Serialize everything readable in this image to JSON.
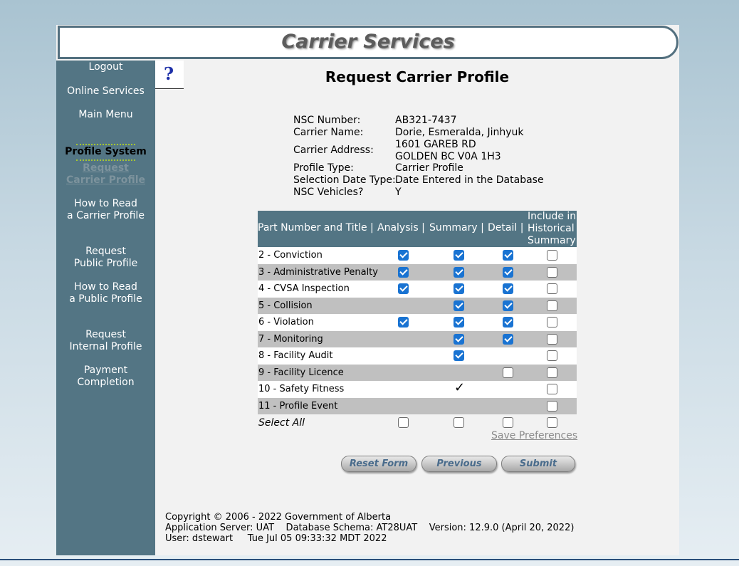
{
  "header": {
    "title": "Carrier Services"
  },
  "sidebar": {
    "items": [
      {
        "label": "Logout"
      },
      {
        "label": "Online Services"
      },
      {
        "label": "Main Menu"
      },
      {
        "label": "Profile System"
      },
      {
        "label_line1": "Request",
        "label_line2": "Carrier Profile"
      },
      {
        "label_line1": "How to Read",
        "label_line2": "a Carrier Profile"
      },
      {
        "label_line1": "Request",
        "label_line2": "Public Profile"
      },
      {
        "label_line1": "How to Read",
        "label_line2": "a Public Profile"
      },
      {
        "label_line1": "Request",
        "label_line2": "Internal Profile"
      },
      {
        "label_line1": "Payment",
        "label_line2": "Completion"
      }
    ]
  },
  "help": {
    "icon": "question-icon",
    "glyph": "?"
  },
  "page_title": "Request Carrier Profile",
  "info": {
    "nsc_number_label": "NSC Number:",
    "nsc_number": "AB321-7437",
    "carrier_name_label": "Carrier Name:",
    "carrier_name": "Dorie, Esmeralda, Jinhyuk",
    "carrier_address_label": "Carrier Address:",
    "carrier_address_line1": "1601 GAREB RD",
    "carrier_address_line2": "GOLDEN BC V0A 1H3",
    "profile_type_label": "Profile Type:",
    "profile_type": "Carrier Profile",
    "selection_date_type_label": "Selection Date Type:",
    "selection_date_type": "Date Entered in the Database",
    "nsc_vehicles_label": "NSC Vehicles?",
    "nsc_vehicles": "Y"
  },
  "table": {
    "headers": {
      "part": "Part Number and Title |",
      "analysis": "Analysis |",
      "summary": "Summary |",
      "detail": "Detail |",
      "hist_line1": "Include in",
      "hist_line2": "Historical",
      "hist_line3": "Summary"
    },
    "rows": [
      {
        "label": "2 - Conviction",
        "analysis": "checked",
        "summary": "checked",
        "detail": "checked",
        "historical": "unchecked"
      },
      {
        "label": "3 - Administrative Penalty",
        "analysis": "checked",
        "summary": "checked",
        "detail": "checked",
        "historical": "unchecked"
      },
      {
        "label": "4 - CVSA Inspection",
        "analysis": "checked",
        "summary": "checked",
        "detail": "checked",
        "historical": "unchecked"
      },
      {
        "label": "5 - Collision",
        "analysis": "none",
        "summary": "checked",
        "detail": "checked",
        "historical": "unchecked"
      },
      {
        "label": "6 - Violation",
        "analysis": "checked",
        "summary": "checked",
        "detail": "checked",
        "historical": "unchecked"
      },
      {
        "label": "7 - Monitoring",
        "analysis": "none",
        "summary": "checked",
        "detail": "checked",
        "historical": "unchecked"
      },
      {
        "label": "8 - Facility Audit",
        "analysis": "none",
        "summary": "checked",
        "detail": "none",
        "historical": "unchecked"
      },
      {
        "label": "9 - Facility Licence",
        "analysis": "none",
        "summary": "none",
        "detail": "unchecked",
        "historical": "unchecked"
      },
      {
        "label": "10 - Safety Fitness",
        "analysis": "none",
        "summary": "tick",
        "detail": "none",
        "historical": "unchecked"
      },
      {
        "label": "11 - Profile Event",
        "analysis": "none",
        "summary": "none",
        "detail": "none",
        "historical": "unchecked"
      }
    ],
    "select_all_label": "Select All",
    "tick_glyph": "✓"
  },
  "links": {
    "save_preferences": "Save Preferences"
  },
  "buttons": {
    "reset": "Reset Form",
    "previous": "Previous",
    "submit": "Submit"
  },
  "footer": {
    "copyright": "Copyright © 2006 - 2022 Government of Alberta",
    "server_line": "Application Server: UAT    Database Schema: AT28UAT    Version: 12.9.0 (April 20, 2022)",
    "user_line": "User: dstewart     Tue Jul 05 09:33:32 MDT 2022"
  },
  "colors": {
    "sidebar": "#537584",
    "checkbox_on": "#1973d2",
    "dots": "#a7c82f",
    "link": "#8b8b8b"
  }
}
